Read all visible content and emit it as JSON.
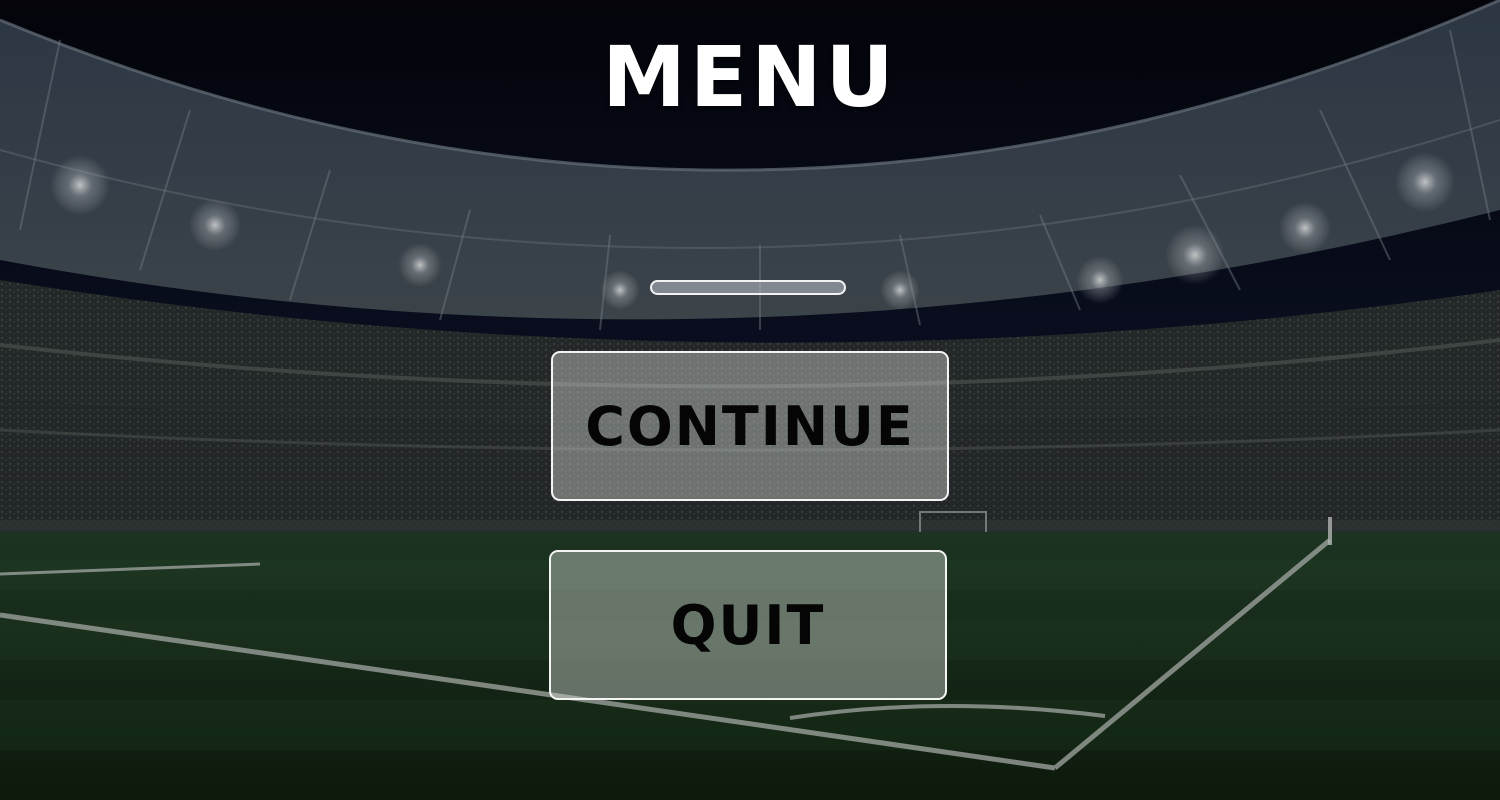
{
  "menu": {
    "title": "MENU"
  },
  "loading_bar": {
    "fill_fraction": 0
  },
  "buttons": {
    "continue_label": "CONTINUE",
    "quit_label": "QUIT"
  },
  "colors": {
    "title_text": "#ffffff",
    "button_text": "#050505",
    "button_border": "#f4f4f4",
    "sky_top": "#05060d",
    "pitch_green": "#1d3a1f"
  },
  "background": {
    "scene": "night-football-stadium-icon"
  }
}
